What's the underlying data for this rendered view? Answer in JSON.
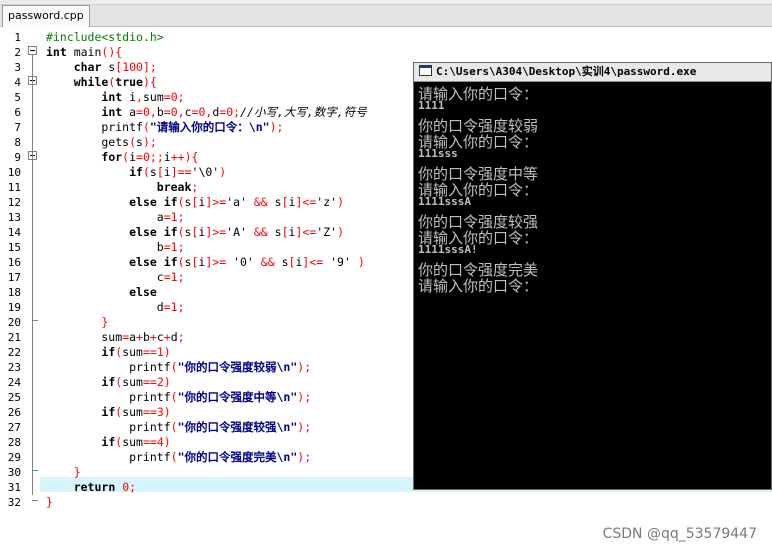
{
  "tab": {
    "label": "password.cpp"
  },
  "editor": {
    "line_numbers": [
      "1",
      "2",
      "3",
      "4",
      "5",
      "6",
      "7",
      "8",
      "9",
      "10",
      "11",
      "12",
      "13",
      "14",
      "15",
      "16",
      "17",
      "18",
      "19",
      "20",
      "21",
      "22",
      "23",
      "24",
      "25",
      "26",
      "27",
      "28",
      "29",
      "30",
      "31",
      "32"
    ],
    "lines": [
      "#include<stdio.h>",
      "int main(){",
      "    char s[100];",
      "    while(true){",
      "        int i,sum=0;",
      "        int a=0,b=0,c=0,d=0;//小写,大写,数字,符号",
      "        printf(\"请输入你的口令：\\n\");",
      "        gets(s);",
      "        for(i=0;;i++){",
      "            if(s[i]=='\\0')",
      "                break;",
      "            else if(s[i]>='a' && s[i]<='z')",
      "                a=1;",
      "            else if(s[i]>='A' && s[i]<='Z')",
      "                b=1;",
      "            else if(s[i]>= '0' && s[i]<= '9' )",
      "                c=1;",
      "            else",
      "                d=1;",
      "        }",
      "        sum=a+b+c+d;",
      "        if(sum==1)",
      "            printf(\"你的口令强度较弱\\n\");",
      "        if(sum==2)",
      "            printf(\"你的口令强度中等\\n\");",
      "        if(sum==3)",
      "            printf(\"你的口令强度较强\\n\");",
      "        if(sum==4)",
      "            printf(\"你的口令强度完美\\n\");",
      "    }",
      "    return 0;",
      "}"
    ],
    "highlighted_line": "31"
  },
  "console": {
    "title": "C:\\Users\\A304\\Desktop\\实训4\\password.exe",
    "lines": [
      {
        "text": "请输入你的口令：",
        "kind": "zh"
      },
      {
        "text": "1111",
        "kind": "en"
      },
      {
        "text": "你的口令强度较弱",
        "kind": "zh"
      },
      {
        "text": "请输入你的口令：",
        "kind": "zh"
      },
      {
        "text": "111sss",
        "kind": "en"
      },
      {
        "text": "你的口令强度中等",
        "kind": "zh"
      },
      {
        "text": "请输入你的口令：",
        "kind": "zh"
      },
      {
        "text": "1111sssA",
        "kind": "en"
      },
      {
        "text": "你的口令强度较强",
        "kind": "zh"
      },
      {
        "text": "请输入你的口令：",
        "kind": "zh"
      },
      {
        "text": "1111sssA!",
        "kind": "en"
      },
      {
        "text": "你的口令强度完美",
        "kind": "zh"
      },
      {
        "text": "请输入你的口令：",
        "kind": "zh"
      }
    ]
  },
  "watermark": "CSDN @qq_53579447",
  "colors": {
    "keyword": "#000000",
    "number": "#ff0000",
    "string": "#00008b",
    "preprocessor": "#008000",
    "highlight": "#d6f4fb",
    "console_bg": "#000000",
    "console_text": "#c0c0c0"
  }
}
